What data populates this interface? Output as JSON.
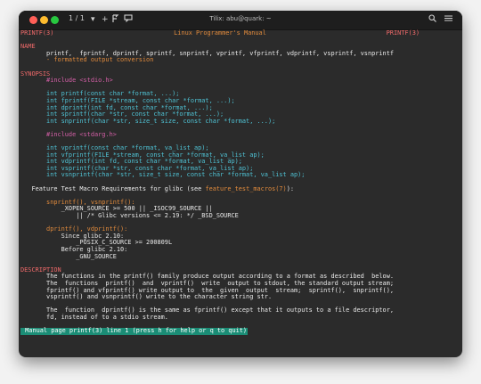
{
  "titlebar": {
    "tab_counter": "1 / 1",
    "chevron": "▾",
    "add": "+",
    "window_title": "Tilix: abu@quark: ~"
  },
  "manpage": {
    "header_left": "PRINTF(3)",
    "header_center": "Linux Programmer's Manual",
    "header_right": "PRINTF(3)",
    "name_heading": "NAME",
    "name_line1": "       printf,  fprintf, dprintf, sprintf, snprintf, vprintf, vfprintf, vdprintf, vsprintf, vsnprintf",
    "name_line2": "       - formatted output conversion",
    "synopsis_heading": "SYNOPSIS",
    "include_stdio": "       #include <stdio.h>",
    "proto_printf": "       int printf(const char *format, ...);",
    "proto_fprintf": "       int fprintf(FILE *stream, const char *format, ...);",
    "proto_dprintf": "       int dprintf(int fd, const char *format, ...);",
    "proto_sprintf": "       int sprintf(char *str, const char *format, ...);",
    "proto_snprintf": "       int snprintf(char *str, size_t size, const char *format, ...);",
    "include_stdarg": "       #include <stdarg.h>",
    "proto_vprintf": "       int vprintf(const char *format, va_list ap);",
    "proto_vfprintf": "       int vfprintf(FILE *stream, const char *format, va_list ap);",
    "proto_vdprintf": "       int vdprintf(int fd, const char *format, va_list ap);",
    "proto_vsprintf": "       int vsprintf(char *str, const char *format, va_list ap);",
    "proto_vsnprintf": "       int vsnprintf(char *str, size_t size, const char *format, va_list ap);",
    "ftm_prefix": "   Feature Test Macro Requirements for glibc (see ",
    "ftm_link": "feature_test_macros(7)",
    "ftm_suffix": "):",
    "ftm_fn1": "       snprintf(), vsnprintf():",
    "ftm_req1": "           _XOPEN_SOURCE >= 500 || _ISOC99_SOURCE ||",
    "ftm_req2": "               || /* Glibc versions <= 2.19: */ _BSD_SOURCE",
    "ftm_fn2": "       dprintf(), vdprintf():",
    "ftm_since": "           Since glibc 2.10:",
    "ftm_posix": "               _POSIX_C_SOURCE >= 200809L",
    "ftm_before": "           Before glibc 2.10:",
    "ftm_gnu": "               _GNU_SOURCE",
    "description_heading": "DESCRIPTION",
    "desc_l1": "       The functions in the printf() family produce output according to a format as described  below.",
    "desc_l2": "       The  functions  printf()  and  vprintf()  write  output to stdout, the standard output stream;",
    "desc_l3": "       fprintf() and vfprintf() write output to  the  given  output  stream;  sprintf(),  snprintf(),",
    "desc_l4": "       vsprintf() and vsnprintf() write to the character string str.",
    "desc_l5": "       The  function  dprintf() is the same as fprintf() except that it outputs to a file descriptor,",
    "desc_l6": "       fd, instead of to a stdio stream.",
    "status_line": " Manual page printf(3) line 1 (press h for help or q to quit)"
  },
  "colors": {
    "status_bg": "#1b8d76",
    "heading": "#f06a6a",
    "function_highlight": "#e08a3c",
    "keyword": "#d35fa6",
    "identifier": "#66d466"
  },
  "icons": [
    "new-terminal-icon",
    "split-icon",
    "broadcast-icon",
    "search-icon",
    "menu-icon"
  ]
}
